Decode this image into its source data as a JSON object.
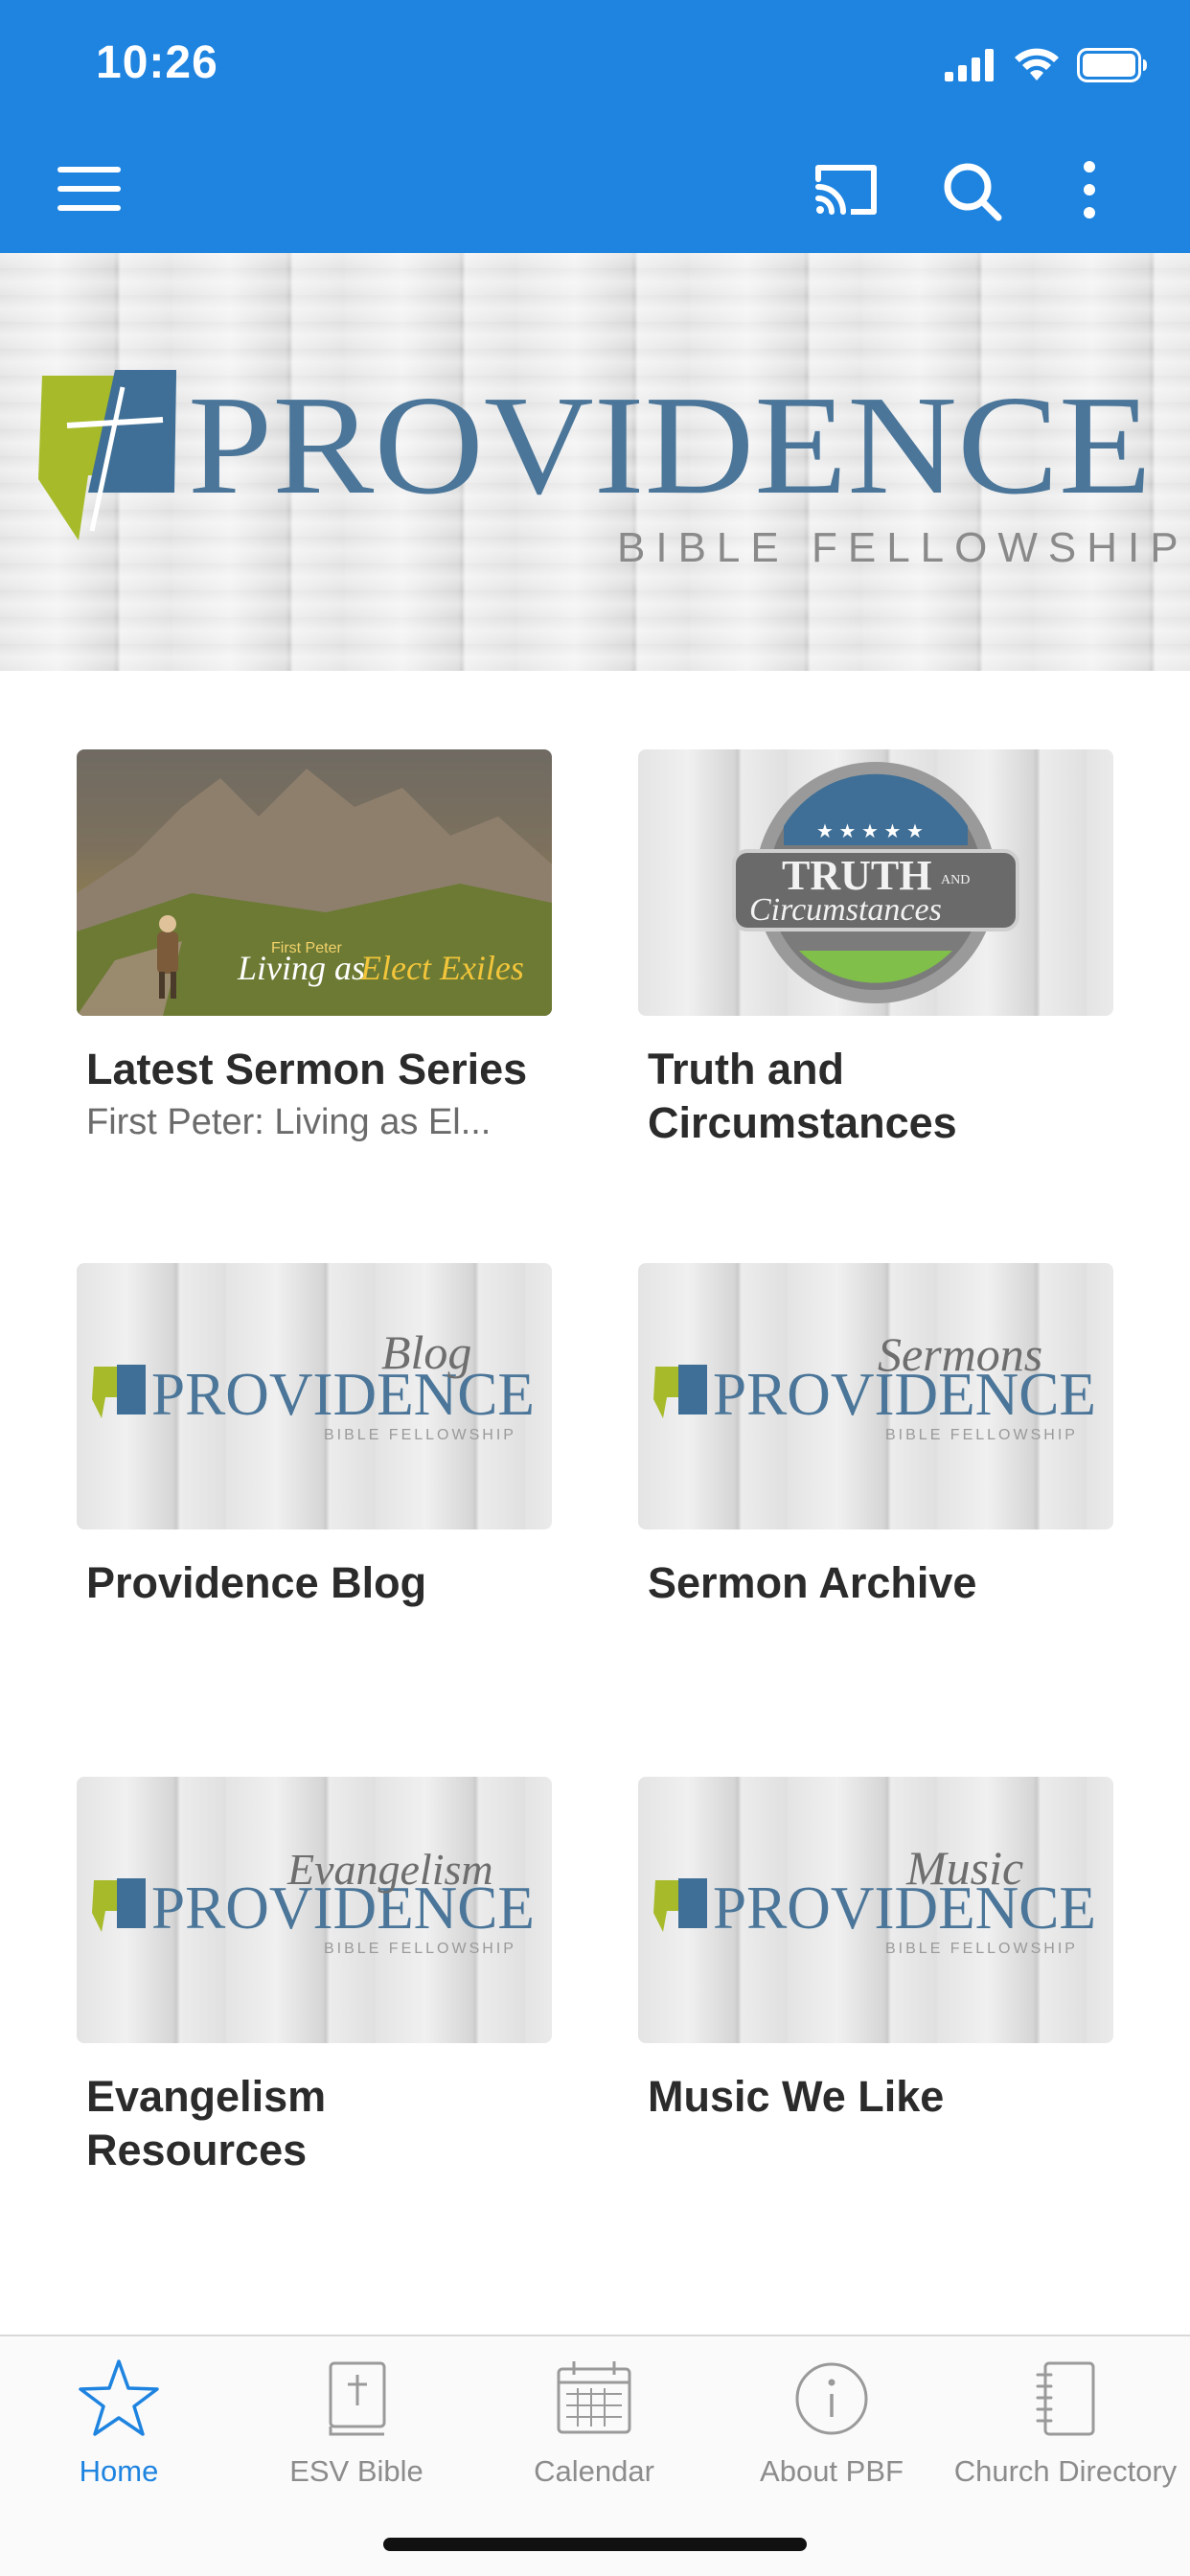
{
  "status": {
    "time": "10:26"
  },
  "hero": {
    "logo_title": "PROVIDENCE",
    "logo_subtitle": "BIBLE FELLOWSHIP"
  },
  "tiles": [
    {
      "title": "Latest Sermon Series",
      "subtitle": "First Peter: Living as El...",
      "thumb_small": "First Peter",
      "thumb_text_a": "Living as",
      "thumb_text_b": "Elect Exiles"
    },
    {
      "title": "Truth and Circumstances",
      "subtitle": "",
      "thumb_text_a": "TRUTH",
      "thumb_text_and": "AND",
      "thumb_text_b": "Circumstances"
    },
    {
      "title": "Providence Blog",
      "subtitle": "",
      "script": "Blog"
    },
    {
      "title": "Sermon Archive",
      "subtitle": "",
      "script": "Sermons"
    },
    {
      "title": "Evangelism Resources",
      "subtitle": "",
      "script": "Evangelism"
    },
    {
      "title": "Music We Like",
      "subtitle": "",
      "script": "Music"
    }
  ],
  "tabs": [
    {
      "label": "Home",
      "icon": "star-icon",
      "active": true
    },
    {
      "label": "ESV Bible",
      "icon": "bible-icon",
      "active": false
    },
    {
      "label": "Calendar",
      "icon": "calendar-icon",
      "active": false
    },
    {
      "label": "About PBF",
      "icon": "info-icon",
      "active": false
    },
    {
      "label": "Church Directory",
      "icon": "notebook-icon",
      "active": false
    }
  ],
  "colors": {
    "brand_blue": "#1e84e0",
    "logo_blue": "#3f6f96",
    "logo_green": "#a7bb2a",
    "text_dark": "#2b2b2b",
    "text_muted": "#8c8c8c"
  }
}
